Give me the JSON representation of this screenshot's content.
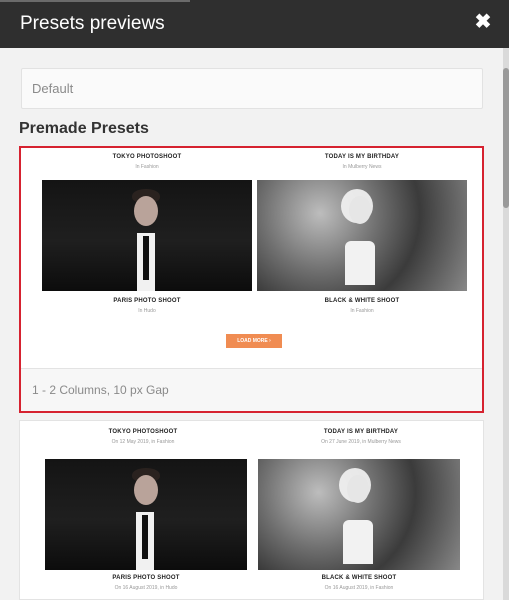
{
  "header": {
    "title": "Presets previews",
    "close_glyph": "✖"
  },
  "default_field": {
    "value": "Default"
  },
  "section": {
    "title": "Premade Presets"
  },
  "presets": [
    {
      "items": [
        {
          "title": "TOKYO PHOTOSHOOT",
          "sub": "In Fashion"
        },
        {
          "title": "TODAY IS MY BIRTHDAY",
          "sub": "In Mulberry News"
        },
        {
          "title": "PARIS PHOTO SHOOT",
          "sub": "In Hudo"
        },
        {
          "title": "BLACK & WHITE SHOOT",
          "sub": "In Fashion"
        }
      ],
      "load_more": "LOAD MORE  ›",
      "caption": "1 - 2 Columns, 10 px Gap"
    },
    {
      "items": [
        {
          "title": "TOKYO PHOTOSHOOT",
          "sub": "On 12 May 2019, in Fashion"
        },
        {
          "title": "TODAY IS MY BIRTHDAY",
          "sub": "On 27 June 2019, in Mulberry News"
        },
        {
          "title": "PARIS PHOTO SHOOT",
          "sub": "On 16 August 2019, in Hudo"
        },
        {
          "title": "BLACK & WHITE SHOOT",
          "sub": "On 16 August 2019, in Fashion"
        }
      ]
    }
  ],
  "colors": {
    "header_bg": "#2f2f2f",
    "selected_border": "#d62230",
    "load_more_bg": "#f08c52"
  },
  "icons": {
    "close": "close-icon"
  }
}
